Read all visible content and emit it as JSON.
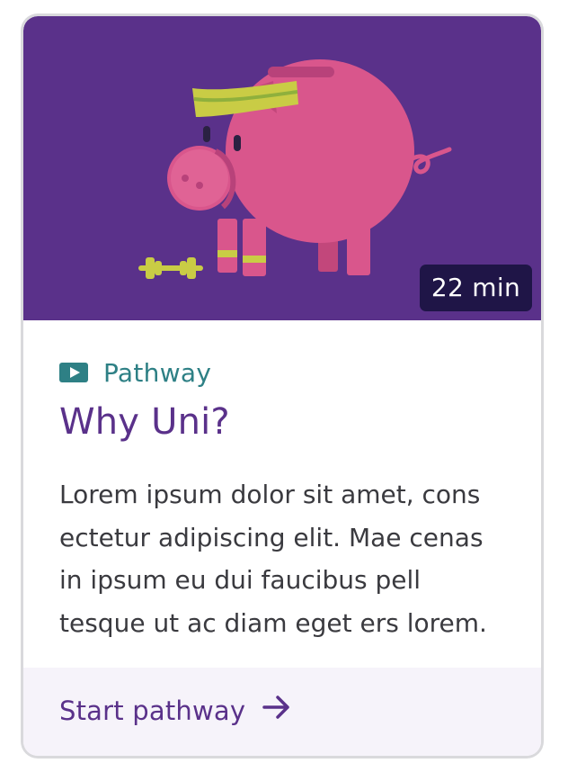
{
  "card": {
    "duration": "22 min",
    "type_label": "Pathway",
    "type_icon": "play-icon",
    "title": "Why Uni?",
    "description": "Lorem ipsum dolor sit amet, cons ectetur adipiscing elit. Mae cenas in ipsum eu dui faucibus pell tesque ut ac diam eget ers lorem.",
    "cta_label": "Start pathway",
    "cta_icon": "arrow-right-icon"
  },
  "colors": {
    "hero_bg": "#5a318a",
    "accent_teal": "#2e8085",
    "title_purple": "#5a318a",
    "badge_bg": "#1f1547",
    "footer_bg": "#f6f3fa",
    "pig_pink": "#d9568c"
  }
}
